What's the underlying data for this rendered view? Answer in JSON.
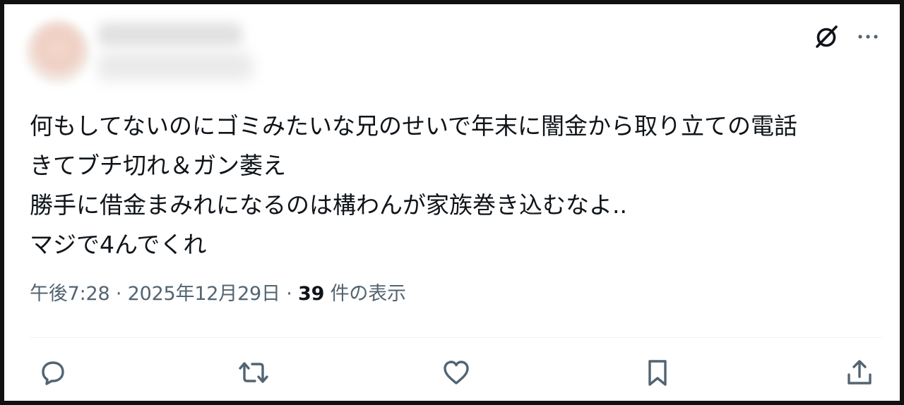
{
  "post": {
    "lines": [
      "何もしてないのにゴミみたいな兄のせいで年末に闇金から取り立ての電話",
      "きてブチ切れ＆ガン萎え",
      "勝手に借金まみれになるのは構わんが家族巻き込むなよ..",
      "マジで4んでくれ"
    ]
  },
  "meta": {
    "time": "午後7:28",
    "sep": "·",
    "date": "2025年12月29日",
    "views_count": "39",
    "views_label": "件の表示"
  },
  "icons": {
    "grok": "grok-icon",
    "more": "more-icon",
    "reply": "reply-icon",
    "repost": "repost-icon",
    "like": "like-icon",
    "bookmark": "bookmark-icon",
    "share": "share-icon"
  },
  "colors": {
    "text": "#0f1419",
    "secondary": "#536471",
    "divider": "#eff3f4",
    "border": "#111111"
  }
}
